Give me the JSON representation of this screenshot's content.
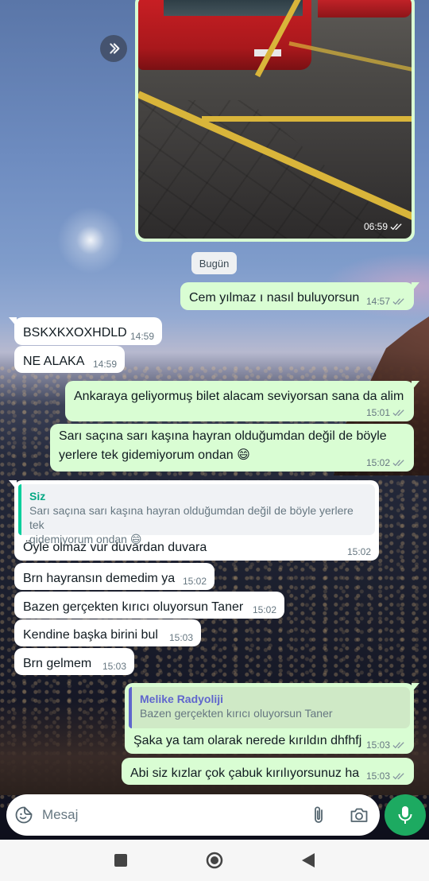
{
  "media_message": {
    "time": "06:59"
  },
  "date_chip": "Bugün",
  "messages": [
    {
      "dir": "out",
      "text": "Cem yılmaz ı nasıl buluyorsun",
      "time": "14:57"
    },
    {
      "dir": "in",
      "text": "BSKXKXOXHDLD",
      "time": "14:59"
    },
    {
      "dir": "in",
      "text": "NE ALAKA",
      "time": "14:59"
    },
    {
      "dir": "out",
      "text": "Ankaraya geliyormuş bilet alacam seviyorsan sana da alim",
      "time": "15:01"
    },
    {
      "dir": "out",
      "text_line1": "Sarı saçına sarı kaşına hayran olduğumdan değil de böyle",
      "text_line2": "yerlere tek gidemiyorum ondan 😄",
      "time": "15:02"
    },
    {
      "dir": "in",
      "quote_author": "Siz",
      "quote_line1": "Sarı saçına sarı kaşına hayran olduğumdan değil de böyle yerlere tek",
      "quote_line2": "gidemiyorum ondan 😄",
      "text": "Öyle olmaz vur duvardan duvara",
      "time": "15:02"
    },
    {
      "dir": "in",
      "text": "Brn hayransın demedim ya",
      "time": "15:02"
    },
    {
      "dir": "in",
      "text": "Bazen gerçekten kırıcı oluyorsun Taner",
      "time": "15:02"
    },
    {
      "dir": "in",
      "text": "Kendine başka birini bul",
      "time": "15:03"
    },
    {
      "dir": "in",
      "text": "Brn gelmem",
      "time": "15:03"
    },
    {
      "dir": "out",
      "quote_author": "Melike Radyoliji",
      "quote_text": "Bazen gerçekten kırıcı oluyorsun Taner",
      "text": "Şaka ya tam olarak nerede kırıldın dhfhfj",
      "time": "15:03"
    },
    {
      "dir": "out",
      "text": "Abi siz kızlar çok çabuk kırılıyorsunuz ha",
      "time": "15:03"
    }
  ],
  "composer": {
    "placeholder": "Mesaj"
  },
  "colors": {
    "outgoing": "#d9fdd3",
    "incoming": "#ffffff",
    "accent": "#1daa61",
    "read_tick": "#53bdeb"
  }
}
